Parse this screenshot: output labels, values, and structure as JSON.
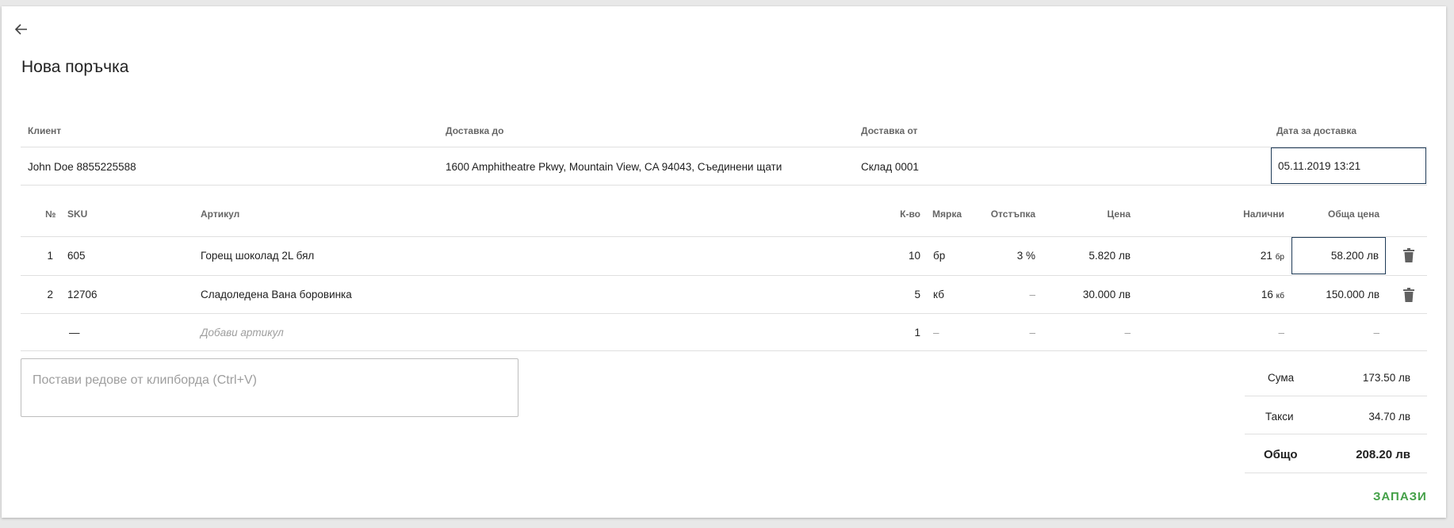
{
  "page": {
    "title": "Нова поръчка"
  },
  "order_header": {
    "columns": {
      "client": "Клиент",
      "deliver_to": "Доставка до",
      "deliver_from": "Доставка от",
      "delivery_date": "Дата за доставка"
    },
    "values": {
      "client": "John Doe 8855225588",
      "deliver_to": "1600 Amphitheatre Pkwy, Mountain View, CA 94043, Съединени щати",
      "deliver_from": "Склад 0001",
      "delivery_date": "05.11.2019 13:21"
    }
  },
  "items_table": {
    "columns": {
      "num": "№",
      "sku": "SKU",
      "article": "Артикул",
      "qty": "К-во",
      "unit": "Мярка",
      "discount": "Отстъпка",
      "price": "Цена",
      "available": "Налични",
      "total": "Обща цена"
    },
    "rows": [
      {
        "num": "1",
        "sku": "605",
        "article": "Горещ шоколад 2L бял",
        "qty": "10",
        "unit": "бр",
        "discount": "3 %",
        "price": "5.820 лв",
        "available": "21",
        "available_unit": "бр",
        "total": "58.200 лв"
      },
      {
        "num": "2",
        "sku": "12706",
        "article": "Сладоледена Вана боровинка",
        "qty": "5",
        "unit": "кб",
        "discount": "–",
        "price": "30.000 лв",
        "available": "16",
        "available_unit": "кб",
        "total": "150.000 лв"
      }
    ],
    "new_row": {
      "sku": "—",
      "article_placeholder": "Добави артикул",
      "qty": "1",
      "unit": "–",
      "discount": "–",
      "price": "–",
      "available": "–",
      "total": "–"
    }
  },
  "paste": {
    "placeholder": "Постави редове от клипборда (Ctrl+V)"
  },
  "summary": {
    "sum_label": "Сума",
    "sum_value": "173.50 лв",
    "tax_label": "Такси",
    "tax_value": "34.70 лв",
    "total_label": "Общо",
    "total_value": "208.20 лв"
  },
  "actions": {
    "save": "ЗАПАЗИ"
  },
  "icons": {
    "back": "arrow-left-icon",
    "delete": "trash-icon"
  },
  "colors": {
    "accent_green": "#43a047",
    "focus_border": "#1f3b57"
  }
}
